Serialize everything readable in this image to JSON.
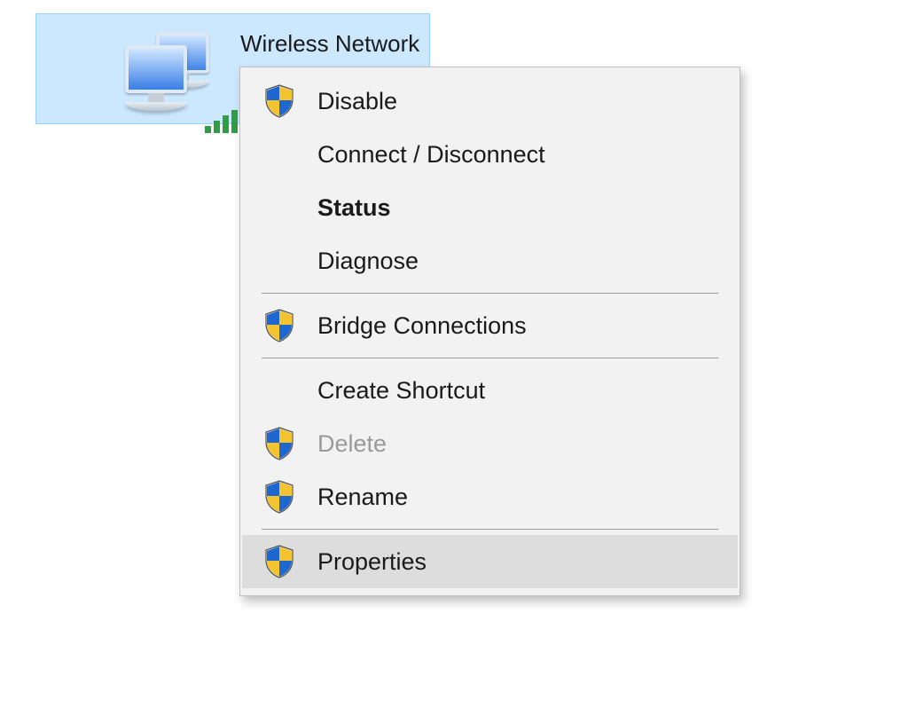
{
  "adapter": {
    "name": "Wireless Network\nConnection",
    "signal_strength": 5
  },
  "context_menu": {
    "groups": [
      [
        {
          "key": "disable",
          "label": "Disable",
          "shield": true,
          "bold": false,
          "disabled": false,
          "hovered": false
        },
        {
          "key": "connect",
          "label": "Connect / Disconnect",
          "shield": false,
          "bold": false,
          "disabled": false,
          "hovered": false
        },
        {
          "key": "status",
          "label": "Status",
          "shield": false,
          "bold": true,
          "disabled": false,
          "hovered": false
        },
        {
          "key": "diagnose",
          "label": "Diagnose",
          "shield": false,
          "bold": false,
          "disabled": false,
          "hovered": false
        }
      ],
      [
        {
          "key": "bridge",
          "label": "Bridge Connections",
          "shield": true,
          "bold": false,
          "disabled": false,
          "hovered": false
        }
      ],
      [
        {
          "key": "shortcut",
          "label": "Create Shortcut",
          "shield": false,
          "bold": false,
          "disabled": false,
          "hovered": false
        },
        {
          "key": "delete",
          "label": "Delete",
          "shield": true,
          "bold": false,
          "disabled": true,
          "hovered": false
        },
        {
          "key": "rename",
          "label": "Rename",
          "shield": true,
          "bold": false,
          "disabled": false,
          "hovered": false
        }
      ],
      [
        {
          "key": "properties",
          "label": "Properties",
          "shield": true,
          "bold": false,
          "disabled": false,
          "hovered": true
        }
      ]
    ]
  }
}
